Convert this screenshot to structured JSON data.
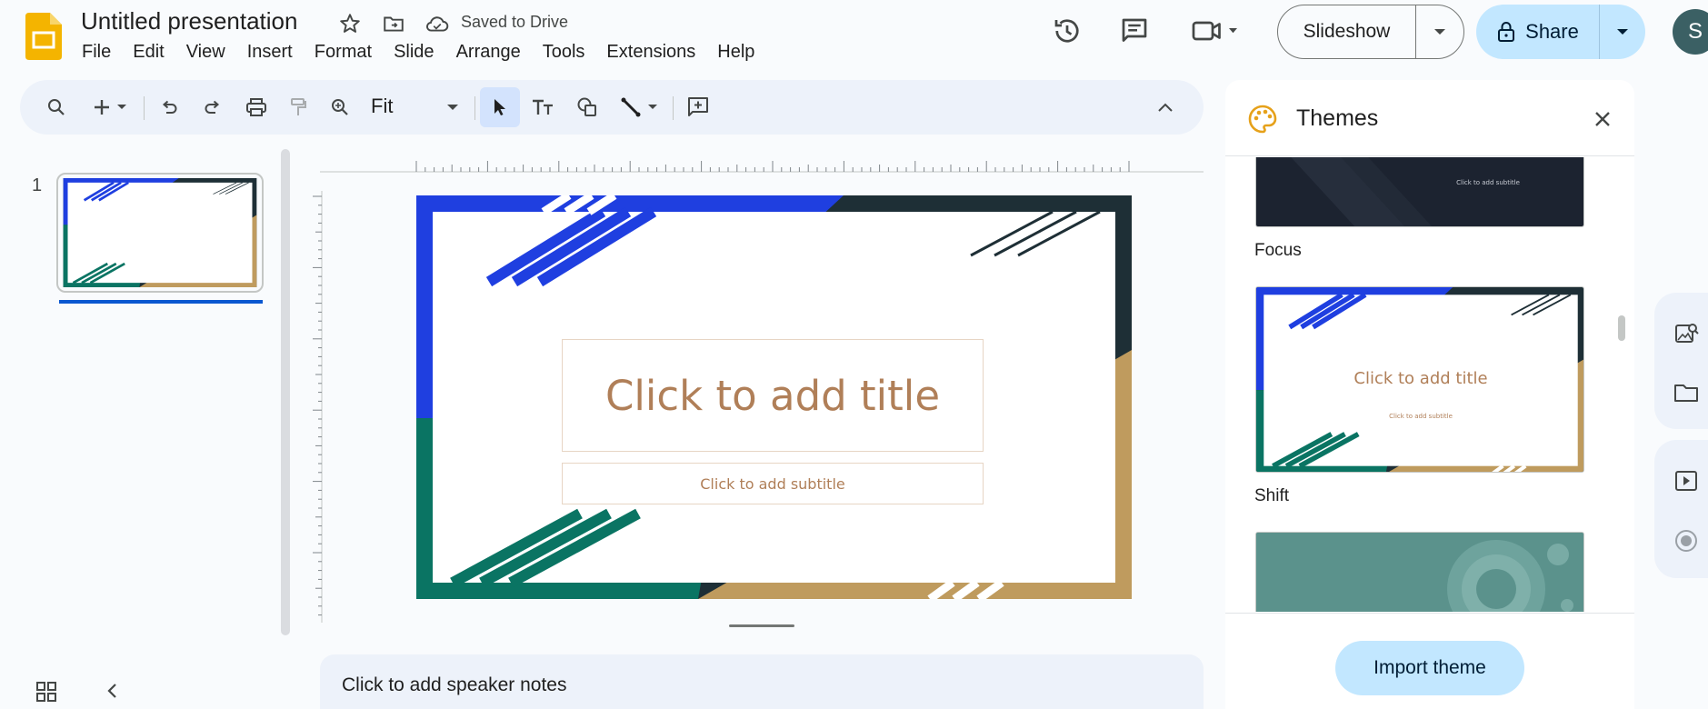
{
  "app": {
    "title": "Untitled presentation",
    "saved_status": "Saved to Drive",
    "avatar_letter": "S",
    "accent": "#0b57d0",
    "logo_color": "#f4b400"
  },
  "menu": [
    "File",
    "Edit",
    "View",
    "Insert",
    "Format",
    "Slide",
    "Arrange",
    "Tools",
    "Extensions",
    "Help"
  ],
  "header": {
    "slideshow_label": "Slideshow",
    "share_label": "Share"
  },
  "toolbar": {
    "zoom_value": "Fit",
    "icons": [
      "search-icon",
      "add-icon",
      "undo-icon",
      "redo-icon",
      "print-icon",
      "paint-format-icon",
      "zoom-icon",
      "select-cursor-icon",
      "text-box-icon",
      "shape-icon",
      "line-icon",
      "add-comment-icon",
      "collapse-toolbar-icon"
    ]
  },
  "filmstrip": {
    "slides": [
      {
        "number": "1"
      }
    ]
  },
  "slide": {
    "title_placeholder": "Click to add title",
    "subtitle_placeholder": "Click to add subtitle",
    "colors": {
      "blue": "#1f3fe0",
      "navy": "#1e2f36",
      "green": "#0a7463",
      "gold": "#bf9b5e",
      "text": "#b07f58"
    }
  },
  "notes": {
    "placeholder": "Click to add speaker notes"
  },
  "themes_panel": {
    "title": "Themes",
    "themes": [
      {
        "name": "Focus",
        "subtitle_text": "Click to add subtitle"
      },
      {
        "name": "Shift",
        "title_text": "Click to add title",
        "subtitle_text": "Click to add subtitle"
      },
      {
        "name": ""
      }
    ],
    "import_label": "Import theme"
  }
}
